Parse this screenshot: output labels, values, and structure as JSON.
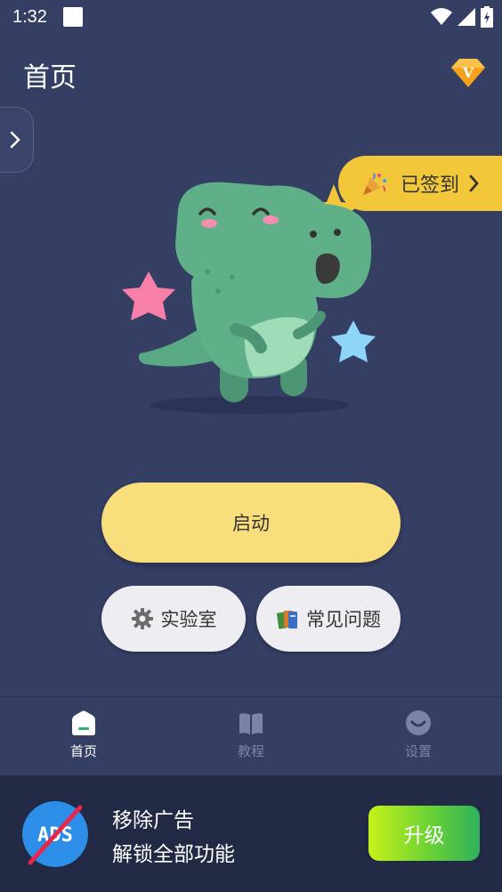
{
  "status_bar": {
    "time": "1:32"
  },
  "header": {
    "title": "首页",
    "vip_icon": "diamond-v-icon",
    "vip_letter": "V"
  },
  "checkin": {
    "label": "已签到",
    "icon": "party-popper-icon"
  },
  "main": {
    "start_label": "启动"
  },
  "actions": {
    "lab_label": "实验室",
    "faq_label": "常见问题"
  },
  "nav": {
    "items": [
      {
        "label": "首页",
        "icon": "home-icon",
        "active": true
      },
      {
        "label": "教程",
        "icon": "book-icon",
        "active": false
      },
      {
        "label": "设置",
        "icon": "smiley-icon",
        "active": false
      }
    ]
  },
  "ad": {
    "line1": "移除广告",
    "line2": "解锁全部功能",
    "upgrade_label": "升级",
    "icon_text": "ADS"
  },
  "colors": {
    "background": "#353e63",
    "accent_yellow": "#f8df7c",
    "checkin_yellow": "#f2c83a",
    "ad_background": "#222945"
  }
}
